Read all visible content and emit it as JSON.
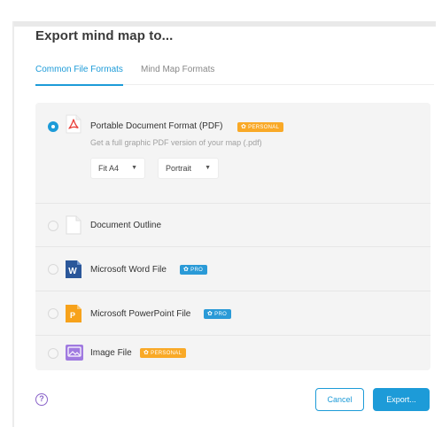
{
  "dialog": {
    "title": "Export mind map to..."
  },
  "tabs": [
    {
      "label": "Common File Formats",
      "active": true
    },
    {
      "label": "Mind Map Formats",
      "active": false
    }
  ],
  "options": [
    {
      "label": "Portable Document Format (PDF)",
      "selected": true,
      "badge": {
        "text": "PERSONAL",
        "type": "personal"
      },
      "description": "Get a full graphic PDF version of your map (.pdf)",
      "icon": "pdf-icon",
      "selects": [
        {
          "value": "Fit A4"
        },
        {
          "value": "Portrait"
        }
      ]
    },
    {
      "label": "Document Outline",
      "selected": false,
      "icon": "document-icon"
    },
    {
      "label": "Microsoft Word File",
      "selected": false,
      "badge": {
        "text": "PRO",
        "type": "pro"
      },
      "icon": "word-icon",
      "icon_letter": "W"
    },
    {
      "label": "Microsoft PowerPoint File",
      "selected": false,
      "badge": {
        "text": "PRO",
        "type": "pro"
      },
      "icon": "powerpoint-icon",
      "icon_letter": "P"
    },
    {
      "label": "Image File",
      "selected": false,
      "badge": {
        "text": "PERSONAL",
        "type": "personal"
      },
      "icon": "image-icon"
    }
  ],
  "footer": {
    "help_glyph": "?",
    "cancel_label": "Cancel",
    "export_label": "Export..."
  },
  "colors": {
    "accent": "#1d9bd8",
    "personal_badge": "#f9a927",
    "pro_badge": "#2a9ad7",
    "pdf_red": "#e9403a",
    "word_blue": "#2b579a",
    "powerpoint_orange": "#f7a21b",
    "image_purple": "#a07ae0",
    "help_purple": "#8a63c9"
  }
}
